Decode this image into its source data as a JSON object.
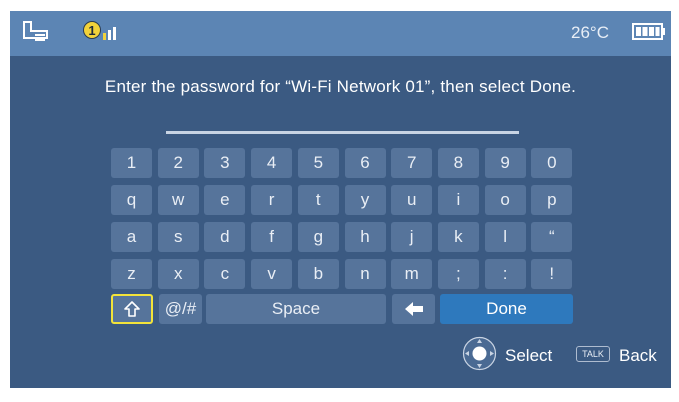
{
  "status_bar": {
    "left_icon": "connect-device-icon",
    "network_badge": "1",
    "signal_icon": "signal-bars-icon",
    "temperature": "26°C",
    "battery_icon": "battery-full-icon"
  },
  "prompt": "Enter the password for “Wi-Fi Network 01”, then select Done.",
  "password_value": "",
  "keyboard": {
    "rows": [
      [
        "1",
        "2",
        "3",
        "4",
        "5",
        "6",
        "7",
        "8",
        "9",
        "0"
      ],
      [
        "q",
        "w",
        "e",
        "r",
        "t",
        "y",
        "u",
        "i",
        "o",
        "p"
      ],
      [
        "a",
        "s",
        "d",
        "f",
        "g",
        "h",
        "j",
        "k",
        "l",
        "“"
      ],
      [
        "z",
        "x",
        "c",
        "v",
        "b",
        "n",
        "m",
        ";",
        ":",
        "!"
      ]
    ],
    "shift_icon": "shift-arrow-icon",
    "symbols_label": "@/#",
    "space_label": "Space",
    "backspace_icon": "backspace-arrow-icon",
    "done_label": "Done"
  },
  "hints": {
    "select_icon": "dpad-icon",
    "select_label": "Select",
    "talk_badge": "TALK",
    "back_label": "Back"
  },
  "colors": {
    "screen_bg": "#3b5a82",
    "status_bar_bg": "#5c85b4",
    "key_bg": "#56749b",
    "done_bg": "#2e79bd",
    "shift_focus": "#f2e33a"
  }
}
